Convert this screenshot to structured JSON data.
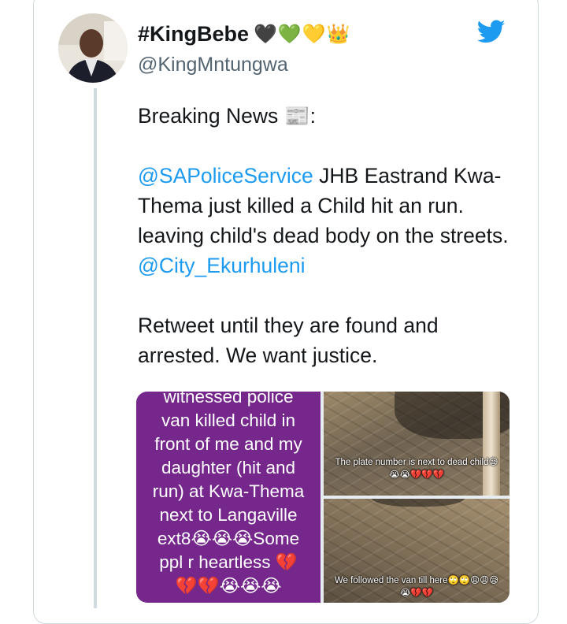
{
  "author": {
    "display_name": "#KingBebe",
    "emojis": "🖤💚💛👑",
    "handle": "@KingMntungwa"
  },
  "icons": {
    "platform": "twitter-bird-icon",
    "platform_color": "#1d9bf0"
  },
  "tweet": {
    "line1": "Breaking News 📰:",
    "p2_mention": "@SAPoliceService",
    "p2_text": " JHB Eastrand Kwa-Thema just killed a Child hit an run. leaving child's dead body on the streets. ",
    "p2_mention2": "@City_Ekurhuleni",
    "p3": "Retweet until they are found and arrested. We want justice."
  },
  "media": {
    "left_lines": [
      "witnessed police",
      "van killed child in",
      "front of me and my",
      "daughter (hit and",
      "run) at Kwa-Thema",
      "next to Langaville",
      "ext8😭😭😭Some",
      "ppl r heartless 💔",
      "💔💔😭😭😭"
    ],
    "top_right_caption": "The plate number is next to dead child😪",
    "top_right_caption2": "😭😭💔💔💔",
    "bottom_right_caption": "We followed the van till here🙄🙄😩😩😪",
    "bottom_right_caption2": "😭💔💔"
  },
  "colors": {
    "mention": "#1d9bf0",
    "media_purple": "#75278c",
    "border": "#cfd9de"
  }
}
